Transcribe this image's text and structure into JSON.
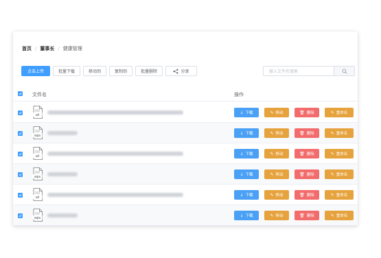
{
  "breadcrumb": {
    "home": "首页",
    "sep": "/",
    "level2": "董事长",
    "current": "健康管理"
  },
  "toolbar": {
    "upload": "点击上传",
    "batch_download": "批量下载",
    "move_to": "移动到",
    "copy_to": "复制到",
    "batch_delete": "批量删除",
    "share": "分享"
  },
  "search": {
    "placeholder": "输入文件名搜索"
  },
  "table": {
    "col_name": "文件名",
    "col_ops": "操作",
    "actions": {
      "download": "下载",
      "move": "移动",
      "delete": "删除",
      "rename": "重命名"
    },
    "rows": [
      {
        "type": "url"
      },
      {
        "type": "wps"
      },
      {
        "type": "url"
      },
      {
        "type": "wps"
      },
      {
        "type": "url"
      },
      {
        "type": "wps"
      }
    ]
  },
  "colors": {
    "primary": "#409eff",
    "warning": "#e6a23c",
    "danger": "#f36c6c"
  }
}
